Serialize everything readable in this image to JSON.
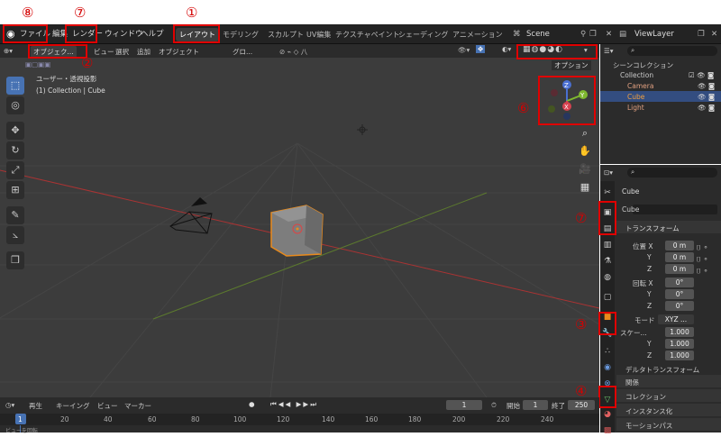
{
  "menus": {
    "file": "ファイル",
    "edit": "編集",
    "render": "レンダー",
    "window": "ウィンドウ",
    "help": "ヘルプ"
  },
  "workspaces": [
    "レイアウト",
    "モデリング",
    "スカルプト",
    "UV編集",
    "テクスチャペイント",
    "シェーディング",
    "アニメーション"
  ],
  "scene": "Scene",
  "view_layer": "ViewLayer",
  "annotations": {
    "a1": "①",
    "a2": "②",
    "a3": "③",
    "a4": "④",
    "a5": "⑤",
    "a6": "⑥",
    "a7a": "⑦",
    "a7b": "⑦",
    "a8": "⑧"
  },
  "viewport_header": {
    "mode": "オブジェク...",
    "view": "ビュー",
    "select": "選択",
    "add": "追加",
    "object": "オブジェクト",
    "orientation": "グロ...",
    "options": "オプション"
  },
  "viewport_info": {
    "line1": "ユーザー・透視投影",
    "line2": "(1) Collection | Cube"
  },
  "gizmo": {
    "x": "X",
    "y": "Y",
    "z": "Z"
  },
  "outliner": {
    "root": "シーンコレクション",
    "collection": "Collection",
    "items": [
      "Camera",
      "Cube",
      "Light"
    ]
  },
  "properties": {
    "object_name": "Cube",
    "datablock": "Cube",
    "transform_label": "トランスフォーム",
    "location_label": "位置 X",
    "rotation_label": "回転 X",
    "mode_label": "モード",
    "mode_value": "XYZ ...",
    "scale_label": "スケー...",
    "loc": [
      "0 m",
      "0 m",
      "0 m"
    ],
    "rot": [
      "0°",
      "0°",
      "0°"
    ],
    "scale": [
      "1.000",
      "1.000",
      "1.000"
    ],
    "y": "Y",
    "z": "Z",
    "delta": "デルタトランスフォーム",
    "relations": "関係",
    "collections": "コレクション",
    "instancing": "インスタンス化",
    "motion_paths": "モーションパス"
  },
  "timeline": {
    "playback": "再生",
    "keying": "キーイング",
    "view": "ビュー",
    "marker": "マーカー",
    "current": "1",
    "start_label": "開始",
    "start": "1",
    "end_label": "終了",
    "end": "250",
    "ticks": [
      "1",
      "20",
      "40",
      "60",
      "80",
      "100",
      "120",
      "140",
      "160",
      "180",
      "200",
      "220",
      "240"
    ]
  },
  "status": {
    "left": "ビューを回転"
  }
}
